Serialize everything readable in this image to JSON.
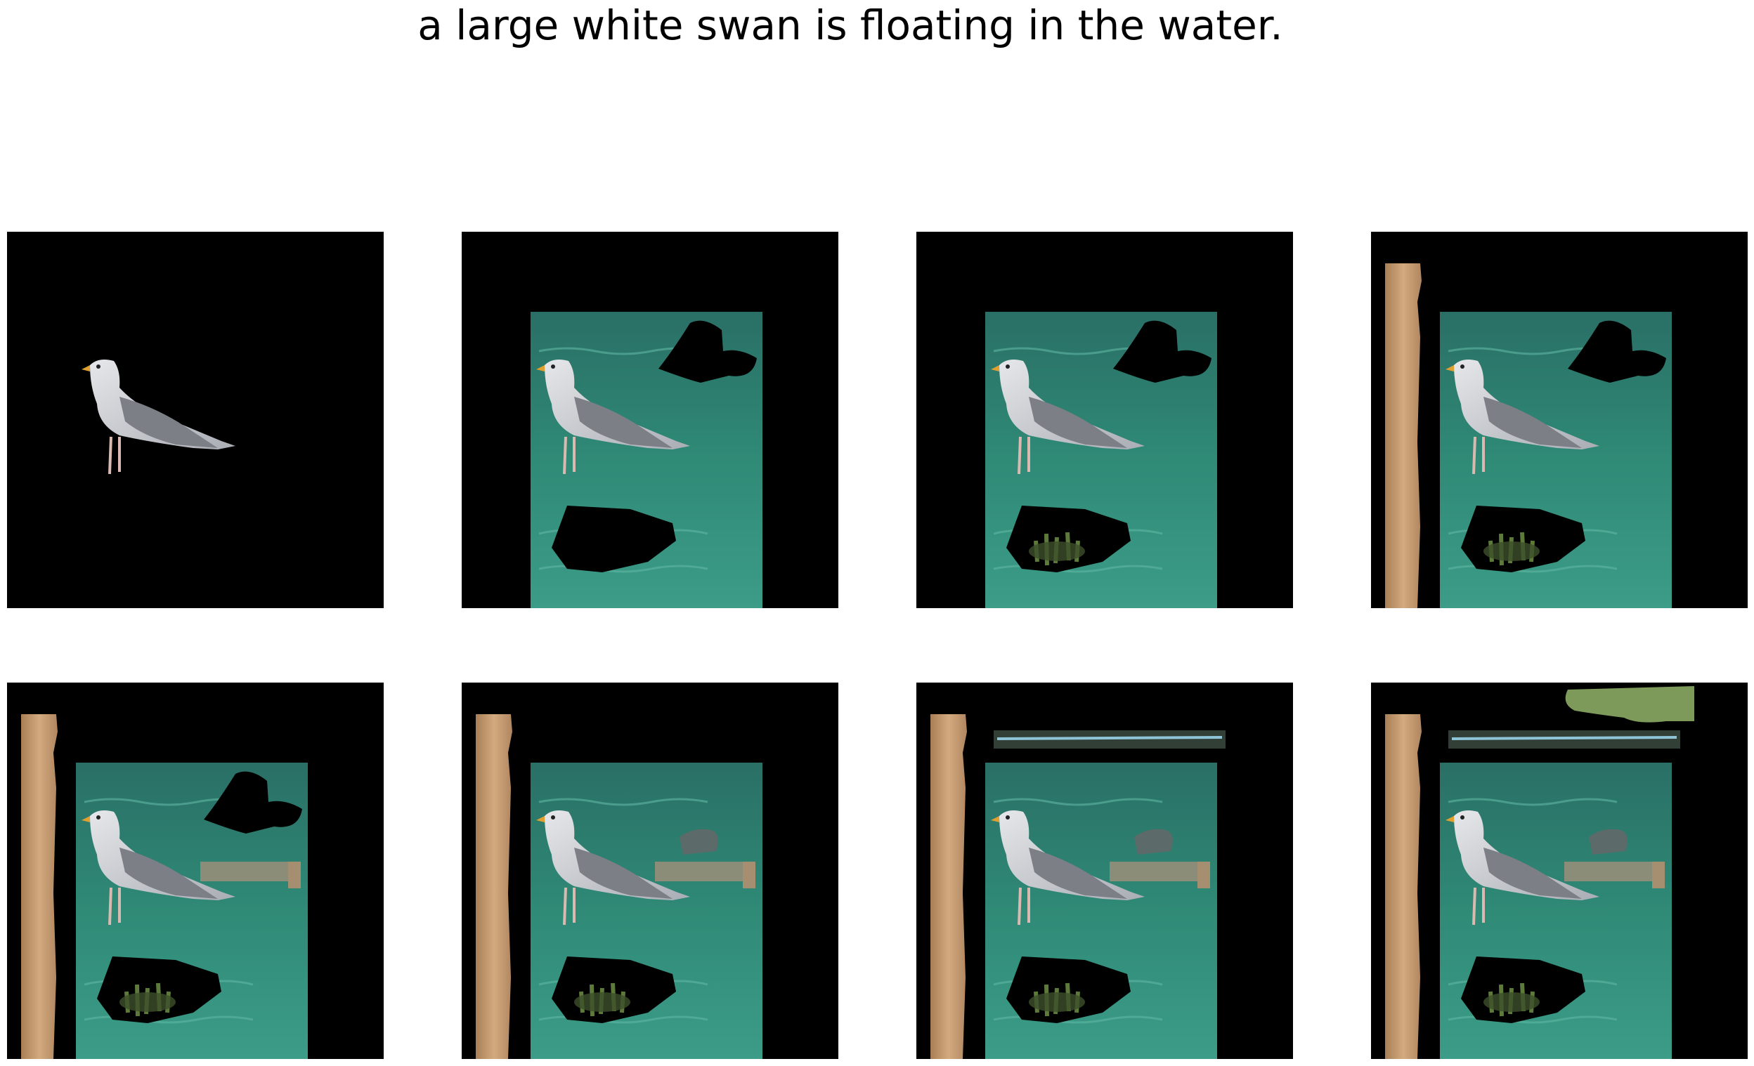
{
  "figure": {
    "caption": "a large white swan is floating in the water."
  },
  "panels": [
    {
      "row": 1,
      "col": 1,
      "layers": [
        "bird"
      ]
    },
    {
      "row": 1,
      "col": 2,
      "layers": [
        "water",
        "hole-top",
        "hole-bottom",
        "bird"
      ]
    },
    {
      "row": 1,
      "col": 3,
      "layers": [
        "water",
        "hole-top",
        "hole-bottom",
        "plants",
        "bird"
      ]
    },
    {
      "row": 1,
      "col": 4,
      "layers": [
        "pole",
        "water",
        "hole-top",
        "hole-bottom",
        "plants",
        "bird"
      ]
    },
    {
      "row": 2,
      "col": 1,
      "layers": [
        "pole",
        "water",
        "hole-top",
        "hole-bottom",
        "plants",
        "ledge",
        "bird"
      ]
    },
    {
      "row": 2,
      "col": 2,
      "layers": [
        "pole",
        "water",
        "hole-bottom",
        "plants",
        "ledge",
        "rocks",
        "bird"
      ]
    },
    {
      "row": 2,
      "col": 3,
      "layers": [
        "pole",
        "water",
        "hole-bottom",
        "plants",
        "ledge",
        "rocks",
        "strip",
        "bird"
      ]
    },
    {
      "row": 2,
      "col": 4,
      "layers": [
        "pole",
        "water",
        "hole-bottom",
        "plants",
        "ledge",
        "rocks",
        "strip",
        "foliage",
        "bird"
      ]
    }
  ],
  "colors": {
    "background": "#000000",
    "water": "#2f8a76",
    "pole": "#c49a6c",
    "bird_body": "#c9cdd3",
    "bird_wing": "#7d7f86"
  }
}
